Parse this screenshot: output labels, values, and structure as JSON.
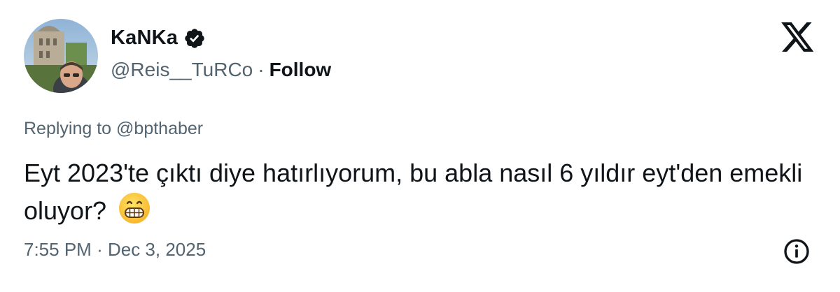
{
  "author": {
    "display_name": "KaNKa",
    "handle": "@Reis__TuRCo",
    "separator": "·",
    "follow_label": "Follow",
    "verified": true,
    "avatar_icon": "profile-photo"
  },
  "reply": {
    "prefix": "Replying to",
    "mention": "@bpthaber"
  },
  "tweet": {
    "text": "Eyt 2023'te çıktı diye hatırlıyorum, bu abla nasıl 6 yıldır eyt'den emekli oluyor?",
    "emoji": "grinning-face-emoji"
  },
  "meta": {
    "time": "7:55 PM",
    "separator": "·",
    "date": "Dec 3, 2025"
  },
  "icons": {
    "logo": "x-logo-icon",
    "info": "info-icon"
  },
  "colors": {
    "text": "#0f1419",
    "secondary": "#536471",
    "background": "#ffffff"
  }
}
